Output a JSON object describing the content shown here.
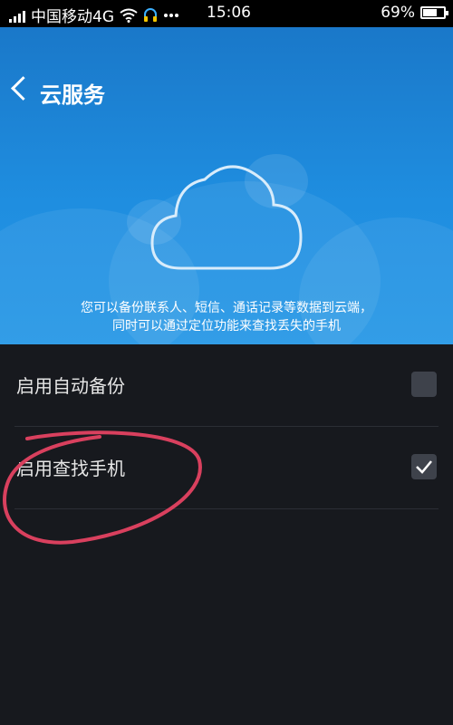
{
  "status_bar": {
    "carrier": "中国移动4G",
    "time": "15:06",
    "battery": "69%",
    "battery_level": 0.69
  },
  "header": {
    "back_icon": "chevron-left-icon",
    "title": "云服务",
    "cloud_icon": "cloud-icon",
    "description_line1": "您可以备份联系人、短信、通话记录等数据到云端，",
    "description_line2": "同时可以通过定位功能来查找丢失的手机",
    "colors": {
      "primary": "#1f8ee0"
    }
  },
  "settings": {
    "items": [
      {
        "label": "启用自动备份",
        "checked": false
      },
      {
        "label": "启用查找手机",
        "checked": true
      }
    ]
  },
  "annotation": {
    "color": "#d9405e"
  }
}
